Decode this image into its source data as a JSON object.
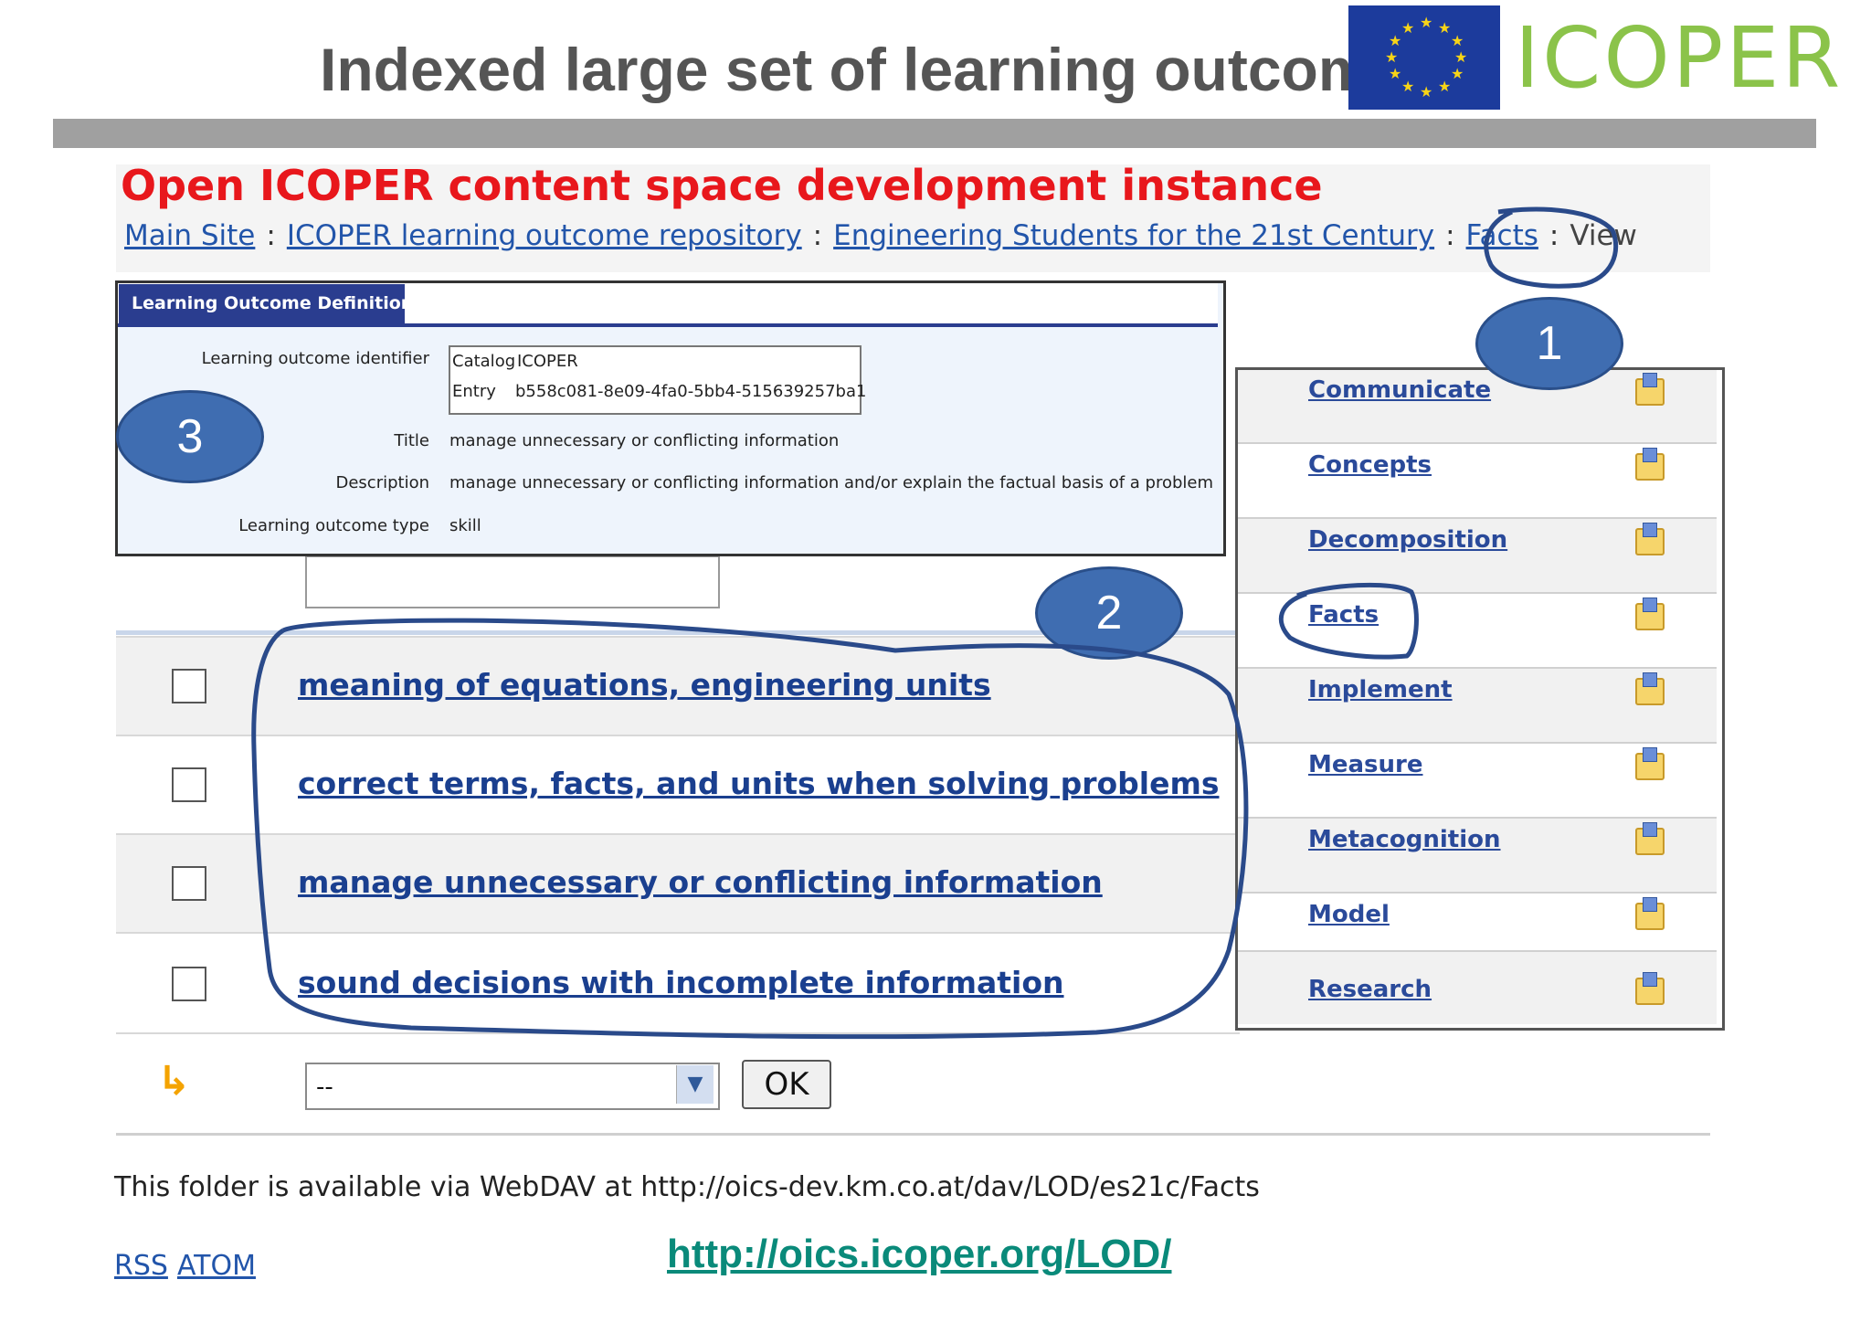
{
  "slide": {
    "title": "Indexed large set of learning outcomes",
    "logo_text": "ICOPER",
    "colors": {
      "title": "#555555",
      "bar": "#a0a0a0",
      "logo": "#8bc34a"
    }
  },
  "site": {
    "title": "Open ICOPER content space development instance",
    "breadcrumb": [
      "Main Site",
      "ICOPER learning outcome repository",
      "Engineering Students for the 21st Century",
      "Facts"
    ],
    "breadcrumb_separator": ":",
    "breadcrumb_current": "View",
    "title_color": "#e8171c",
    "link_color": "#2255aa"
  },
  "definition_panel": {
    "tab_label": "Learning Outcome Definition",
    "fields": {
      "identifier_label": "Learning outcome identifier",
      "catalog_label": "Catalog",
      "catalog_value": "ICOPER",
      "entry_label": "Entry",
      "entry_value": "b558c081-8e09-4fa0-5bb4-515639257ba1",
      "title_label": "Title",
      "title_value": "manage unnecessary or conflicting information",
      "description_label": "Description",
      "description_value": "manage unnecessary or conflicting information and/or explain the factual basis of a problem",
      "type_label": "Learning outcome type",
      "type_value": "skill"
    }
  },
  "learning_outcomes": [
    "meaning of equations, engineering units",
    "correct terms, facts, and units when solving problems",
    "manage unnecessary or conflicting information",
    "sound decisions with incomplete information"
  ],
  "action_bar": {
    "select_value": "--",
    "ok_label": "OK",
    "arrow_icon": "return-arrow-icon"
  },
  "categories": [
    "Communicate",
    "Concepts",
    "Decomposition",
    "Facts",
    "Implement",
    "Measure",
    "Metacognition",
    "Model",
    "Research"
  ],
  "footer": {
    "webdav_text": "This folder is available via WebDAV at http://oics-dev.km.co.at/dav/LOD/es21c/Facts",
    "rss": "RSS",
    "atom": "ATOM",
    "url": "http://oics.icoper.org/LOD/"
  },
  "callouts": [
    "1",
    "2",
    "3"
  ],
  "annotation_color": "#2a4a8a"
}
